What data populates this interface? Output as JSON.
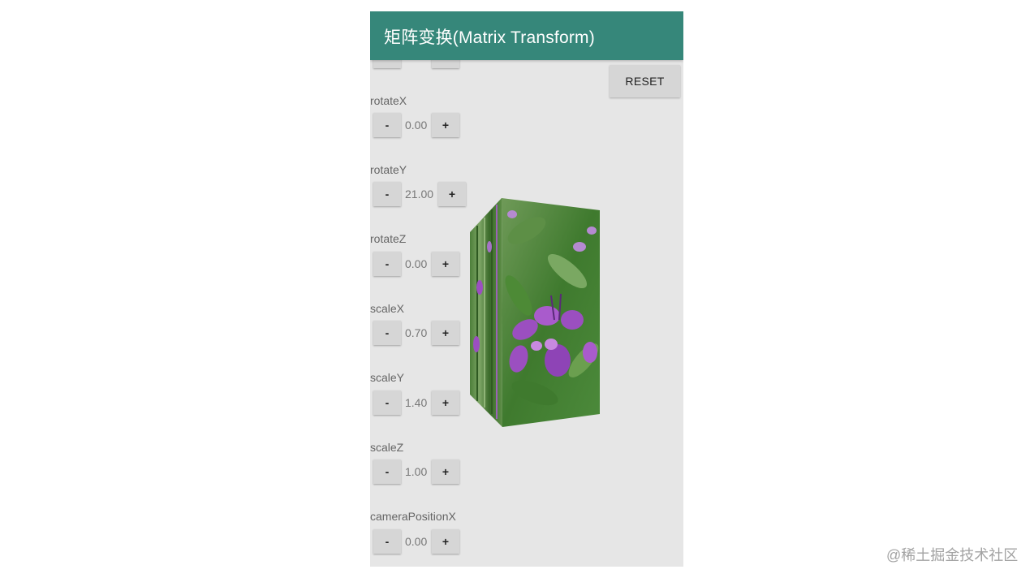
{
  "app": {
    "title": "矩阵变换(Matrix Transform)",
    "theme_color": "#36877a"
  },
  "toolbar": {
    "reset_label": "RESET"
  },
  "controls": [
    {
      "label": "rotateX",
      "value": "0.00",
      "minus": "-",
      "plus": "+"
    },
    {
      "label": "rotateY",
      "value": "21.00",
      "minus": "-",
      "plus": "+"
    },
    {
      "label": "rotateZ",
      "value": "0.00",
      "minus": "-",
      "plus": "+"
    },
    {
      "label": "scaleX",
      "value": "0.70",
      "minus": "-",
      "plus": "+"
    },
    {
      "label": "scaleY",
      "value": "1.40",
      "minus": "-",
      "plus": "+"
    },
    {
      "label": "scaleZ",
      "value": "1.00",
      "minus": "-",
      "plus": "+"
    },
    {
      "label": "cameraPositionX",
      "value": "0.00",
      "minus": "-",
      "plus": "+"
    }
  ],
  "preview": {
    "subject": "purple flowers photo",
    "flower_color": "#9b4fc0",
    "leaf_color": "#3f7a2e"
  },
  "watermark": {
    "text": "@稀土掘金技术社区"
  }
}
